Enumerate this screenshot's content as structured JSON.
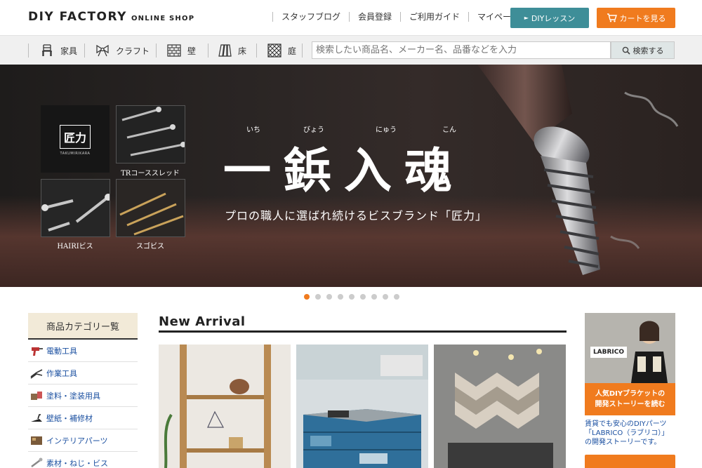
{
  "header": {
    "logo_main": "DIY FACTORY",
    "logo_sub": "ONLINE SHOP",
    "nav": [
      "スタッフブログ",
      "会員登録",
      "ご利用ガイド",
      "マイページ"
    ],
    "lesson_label": "DIYレッスン",
    "cart_label": "カートを見る",
    "colors": {
      "lesson": "#3e8e98",
      "cart": "#f07b1e"
    }
  },
  "categories": [
    {
      "label": "家具",
      "icon": "chair-icon"
    },
    {
      "label": "クラフト",
      "icon": "ribbon-icon"
    },
    {
      "label": "壁",
      "icon": "brick-wall-icon"
    },
    {
      "label": "床",
      "icon": "floorboard-icon"
    },
    {
      "label": "庭",
      "icon": "lattice-icon"
    }
  ],
  "search": {
    "placeholder": "検索したい商品名、メーカー名、品番などを入力",
    "button_label": "検索する"
  },
  "hero": {
    "brand_logo": "匠力",
    "brand_logo_sub": "TAKUMIRIKARA",
    "thumb_captions": [
      "TRコーススレッド",
      "HAIRIビス",
      "スゴビス"
    ],
    "title_chars": [
      "一",
      "鋲",
      "入",
      "魂"
    ],
    "ruby": [
      "いち",
      "びょう",
      "にゅう",
      "こん"
    ],
    "subtitle": "プロの職人に選ばれ続けるビスブランド「匠力」"
  },
  "carousel": {
    "count": 9,
    "active": 1
  },
  "sidebar": {
    "heading": "商品カテゴリー覧",
    "items": [
      {
        "label": "電動工具",
        "icon": "drill-icon"
      },
      {
        "label": "作業工具",
        "icon": "pliers-icon"
      },
      {
        "label": "塗料・塗装用具",
        "icon": "paint-icon"
      },
      {
        "label": "壁紙・補修材",
        "icon": "trowel-icon"
      },
      {
        "label": "インテリアパーツ",
        "icon": "interior-icon"
      },
      {
        "label": "素材・ねじ・ビス",
        "icon": "screw-icon"
      }
    ]
  },
  "new_arrival": {
    "title": "New Arrival"
  },
  "right_banner": {
    "photo_label": "LABRICO",
    "orange_text": "人気DIYブラケットの\n開発ストーリーを読む",
    "caption": "賃貸でも安心のDIYパーツ「LABRICO（ラブリコ）」の開発ストーリーです。"
  }
}
